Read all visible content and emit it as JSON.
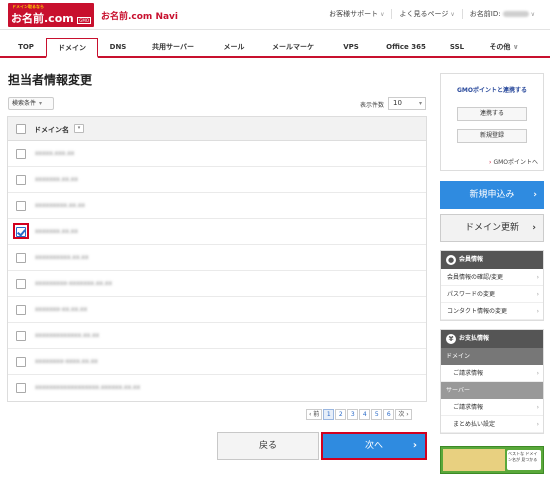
{
  "header": {
    "logo_small": "ドメイン取るなら",
    "logo_main": "お名前.com",
    "logo_tag": "GMO",
    "app_name": "お名前.com Navi",
    "links": [
      {
        "label": "お客様サポート"
      },
      {
        "label": "よく見るページ"
      },
      {
        "label": "お名前ID:"
      }
    ]
  },
  "nav": {
    "tabs": [
      {
        "label": "TOP"
      },
      {
        "label": "ドメイン"
      },
      {
        "label": "DNS"
      },
      {
        "label": "共用サーバー"
      },
      {
        "label": "メール"
      },
      {
        "label": "メールマーケ"
      },
      {
        "label": "VPS"
      },
      {
        "label": "Office 365"
      },
      {
        "label": "SSL"
      },
      {
        "label": "その他"
      }
    ],
    "active": "ドメイン"
  },
  "main": {
    "title": "担当者情報変更",
    "search_label": "検索条件",
    "perpage_label": "表示件数",
    "perpage_value": "10",
    "table": {
      "header_label": "ドメイン名",
      "rows": [
        {
          "domain": "xxxxx.xxx.xx",
          "checked": false
        },
        {
          "domain": "xxxxxxx.xx.xx",
          "checked": false
        },
        {
          "domain": "xxxxxxxxx.xx.xx",
          "checked": false
        },
        {
          "domain": "xxxxxxx.xx.xx",
          "checked": true
        },
        {
          "domain": "xxxxxxxxxx.xx.xx",
          "checked": false
        },
        {
          "domain": "xxxxxxxxx-xxxxxxx.xx.xx",
          "checked": false
        },
        {
          "domain": "xxxxxxx-xx.xx.xx",
          "checked": false
        },
        {
          "domain": "xxxxxxxxxxxxx.xx.xx",
          "checked": false
        },
        {
          "domain": "xxxxxxxx-xxxx.xx.xx",
          "checked": false
        },
        {
          "domain": "xxxxxxxxxxxxxxxxxx.xxxxxx.xx.xx",
          "checked": false
        }
      ]
    },
    "pagination": {
      "prev": "‹ 前",
      "pages": [
        "1",
        "2",
        "3",
        "4",
        "5",
        "6"
      ],
      "current": "1",
      "next": "次 ›"
    },
    "back_button": "戻る",
    "next_button": "次へ"
  },
  "sidebar": {
    "gmo": {
      "title": "GMOポイントと連携する",
      "link_button": "連携する",
      "register_button": "新規登録",
      "point_link": "GMOポイントへ"
    },
    "new_apply": "新規申込み",
    "domain_renew": "ドメイン更新",
    "member": {
      "title": "会員情報",
      "items": [
        {
          "label": "会員情報の確認/変更"
        },
        {
          "label": "パスワードの変更"
        },
        {
          "label": "コンタクト情報の変更"
        }
      ]
    },
    "payment": {
      "title": "お支払情報",
      "sections": [
        {
          "title": "ドメイン",
          "items": [
            {
              "label": "ご請求情報"
            }
          ]
        },
        {
          "title": "サーバー",
          "items": [
            {
              "label": "ご請求情報"
            },
            {
              "label": "まとめ払い設定"
            }
          ]
        }
      ]
    },
    "banner": {
      "text": "ベストな ドメイン名が 見つかる"
    }
  },
  "colors": {
    "brand_red": "#c8102e",
    "primary_blue": "#2f8be0",
    "highlight_red": "#d2001f",
    "panel_dark": "#555555"
  }
}
